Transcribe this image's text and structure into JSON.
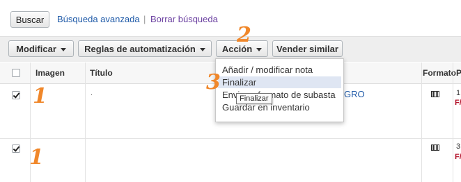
{
  "search": {
    "button_label": "Buscar",
    "advanced_link": "Búsqueda avanzada",
    "separator": "|",
    "clear_link": "Borrar búsqueda"
  },
  "toolbar": {
    "modify_label": "Modificar",
    "rules_label": "Reglas de automatización",
    "action_label": "Acción",
    "sell_similar_label": "Vender similar"
  },
  "table": {
    "headers": {
      "image": "Imagen",
      "title": "Título",
      "format": "Formato",
      "price": "Pr"
    },
    "rows": [
      {
        "checked": true,
        "title": ".",
        "link_tail": "GRO",
        "price_digit": "1",
        "price_tag": "F/"
      },
      {
        "checked": true,
        "title": "",
        "link_tail": "",
        "price_digit": "3",
        "price_tag": "F/"
      }
    ]
  },
  "action_menu": {
    "items": [
      "Añadir / modificar nota",
      "Finalizar",
      "Enviar a formato de subasta",
      "Guardar en inventario"
    ],
    "highlighted_index": 1
  },
  "tooltip": "Finalizar",
  "annotations": {
    "row1_step": "1",
    "row2_step": "1",
    "action_step": "2",
    "finalize_step": "3"
  },
  "colors": {
    "link": "#1f5aa8",
    "annotation": "#f0872a",
    "menu_highlight": "#dfe6f3",
    "price_red": "#b3122a"
  }
}
